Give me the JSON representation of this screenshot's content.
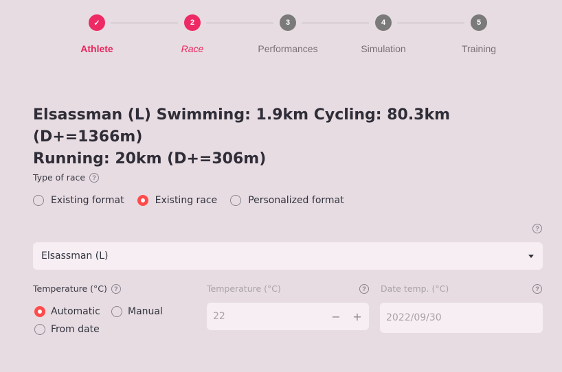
{
  "stepper": {
    "steps": [
      {
        "label": "Athlete",
        "number": "✓",
        "state": "done"
      },
      {
        "label": "Race",
        "number": "2",
        "state": "active"
      },
      {
        "label": "Performances",
        "number": "3",
        "state": "todo"
      },
      {
        "label": "Simulation",
        "number": "4",
        "state": "todo"
      },
      {
        "label": "Training",
        "number": "5",
        "state": "todo"
      }
    ]
  },
  "race": {
    "title_line1": "Elsassman (L) Swimming: 1.9km Cycling: 80.3km (D+=1366m)",
    "title_line2": "Running: 20km (D+=306m)"
  },
  "type_of_race": {
    "label": "Type of race",
    "options": [
      "Existing format",
      "Existing race",
      "Personalized format"
    ],
    "selected": "Existing race"
  },
  "race_select": {
    "value": "Elsassman (L)"
  },
  "temperature_mode": {
    "label": "Temperature (°C)",
    "options": [
      "Automatic",
      "Manual",
      "From date"
    ],
    "selected": "Automatic"
  },
  "temperature_input": {
    "label": "Temperature (°C)",
    "value": "22",
    "minus": "−",
    "plus": "+"
  },
  "date_temp": {
    "label": "Date temp. (°C)",
    "value": "2022/09/30"
  },
  "help_glyph": "?",
  "colors": {
    "accent": "#ee2a64",
    "radio": "#ff4b4b",
    "background": "#e7dce1",
    "field": "#f6eef2"
  }
}
